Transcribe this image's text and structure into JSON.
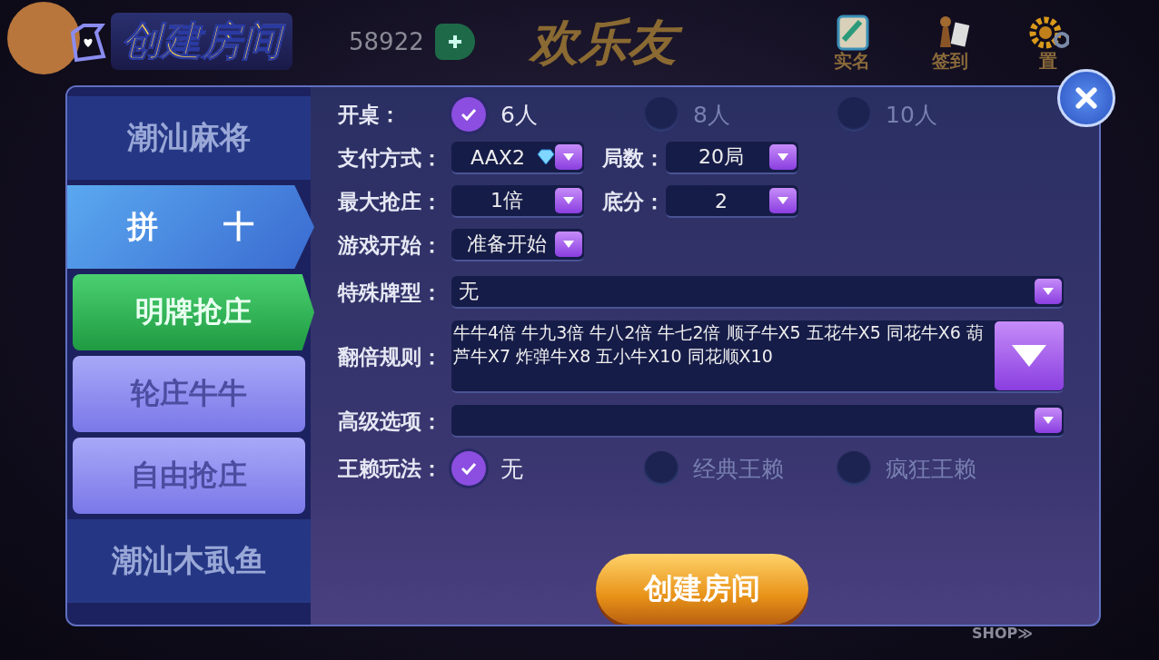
{
  "top_bar": {
    "coins": "58922",
    "logo": "欢乐友",
    "icons": [
      {
        "kind": "notebook",
        "label": "实名"
      },
      {
        "kind": "chess",
        "label": "签到"
      },
      {
        "kind": "gear",
        "label": "置"
      }
    ],
    "shop": "SHOP≫"
  },
  "dialog": {
    "title": "创建房间",
    "sidebar": [
      {
        "label": "潮汕麻将",
        "selected": false
      },
      {
        "label": "拼 十",
        "selected": true,
        "expanded": true,
        "children": [
          {
            "label": "明牌抢庄",
            "selected": true
          },
          {
            "label": "轮庄牛牛",
            "selected": false
          },
          {
            "label": "自由抢庄",
            "selected": false
          }
        ]
      },
      {
        "label": "潮汕木虱鱼",
        "selected": false
      }
    ],
    "form": [
      {
        "kind": "radio",
        "label": "开桌：",
        "options": [
          {
            "label": "6人",
            "selected": true
          },
          {
            "label": "8人",
            "selected": false
          },
          {
            "label": "10人",
            "selected": false
          }
        ]
      },
      {
        "kind": "selects",
        "fields": [
          {
            "label": "支付方式：",
            "value": "AAX2",
            "gem": true
          },
          {
            "label": "局数：",
            "value": "20局"
          }
        ]
      },
      {
        "kind": "selects",
        "fields": [
          {
            "label": "最大抢庄：",
            "value": "1倍"
          },
          {
            "label": "底分：",
            "value": "2"
          }
        ]
      },
      {
        "kind": "selects",
        "fields": [
          {
            "label": "游戏开始：",
            "value": "准备开始"
          }
        ]
      },
      {
        "kind": "wide",
        "label": "特殊牌型：",
        "value": "无"
      },
      {
        "kind": "multi",
        "label": "翻倍规则：",
        "value": "牛牛4倍 牛九3倍 牛八2倍 牛七2倍 顺子牛X5 五花牛X5 同花牛X6 葫芦牛X7 炸弹牛X8 五小牛X10 同花顺X10"
      },
      {
        "kind": "wide",
        "label": "高级选项："
      },
      {
        "kind": "radio",
        "label": "王赖玩法：",
        "options": [
          {
            "label": "无",
            "selected": true
          },
          {
            "label": "经典王赖",
            "selected": false
          },
          {
            "label": "疯狂王赖",
            "selected": false
          }
        ]
      }
    ],
    "create_button": "创建房间"
  }
}
